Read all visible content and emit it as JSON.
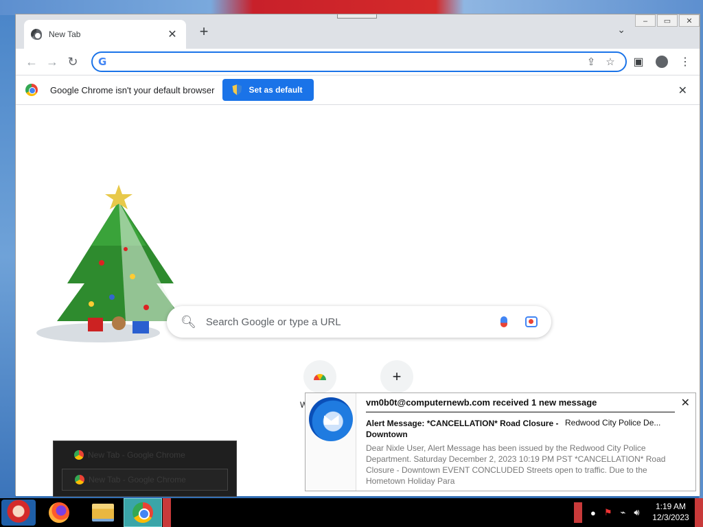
{
  "tab": {
    "title": "New Tab",
    "close": "✕"
  },
  "toolbar": {
    "back": "←",
    "forward": "→",
    "reload": "↻",
    "omnibox_value": ""
  },
  "infobar": {
    "message": "Google Chrome isn't your default browser",
    "button": "Set as default",
    "close": "✕"
  },
  "ntp": {
    "search_placeholder": "Search Google or type a URL",
    "shortcut_label": "W",
    "add_shortcut": "+"
  },
  "thumbnails": [
    {
      "title": "New Tab - Google Chrome"
    },
    {
      "title": "New Tab - Google Chrome"
    }
  ],
  "notification": {
    "heading": "vm0b0t@computernewb.com received 1 new message",
    "subject": "Alert Message: *CANCELLATION* Road Closure - Downtown",
    "sender": "Redwood City Police De...",
    "preview": "Dear Nixle User, Alert Message has been issued by the Redwood City Police Department. Saturday December 2, 2023 10:19 PM PST *CANCELLATION* Road Closure - Downtown EVENT CONCLUDED Streets open to traffic. Due to the Hometown Holiday Para",
    "close": "✕"
  },
  "clock": {
    "time": "1:19 AM",
    "date": "12/3/2023"
  }
}
